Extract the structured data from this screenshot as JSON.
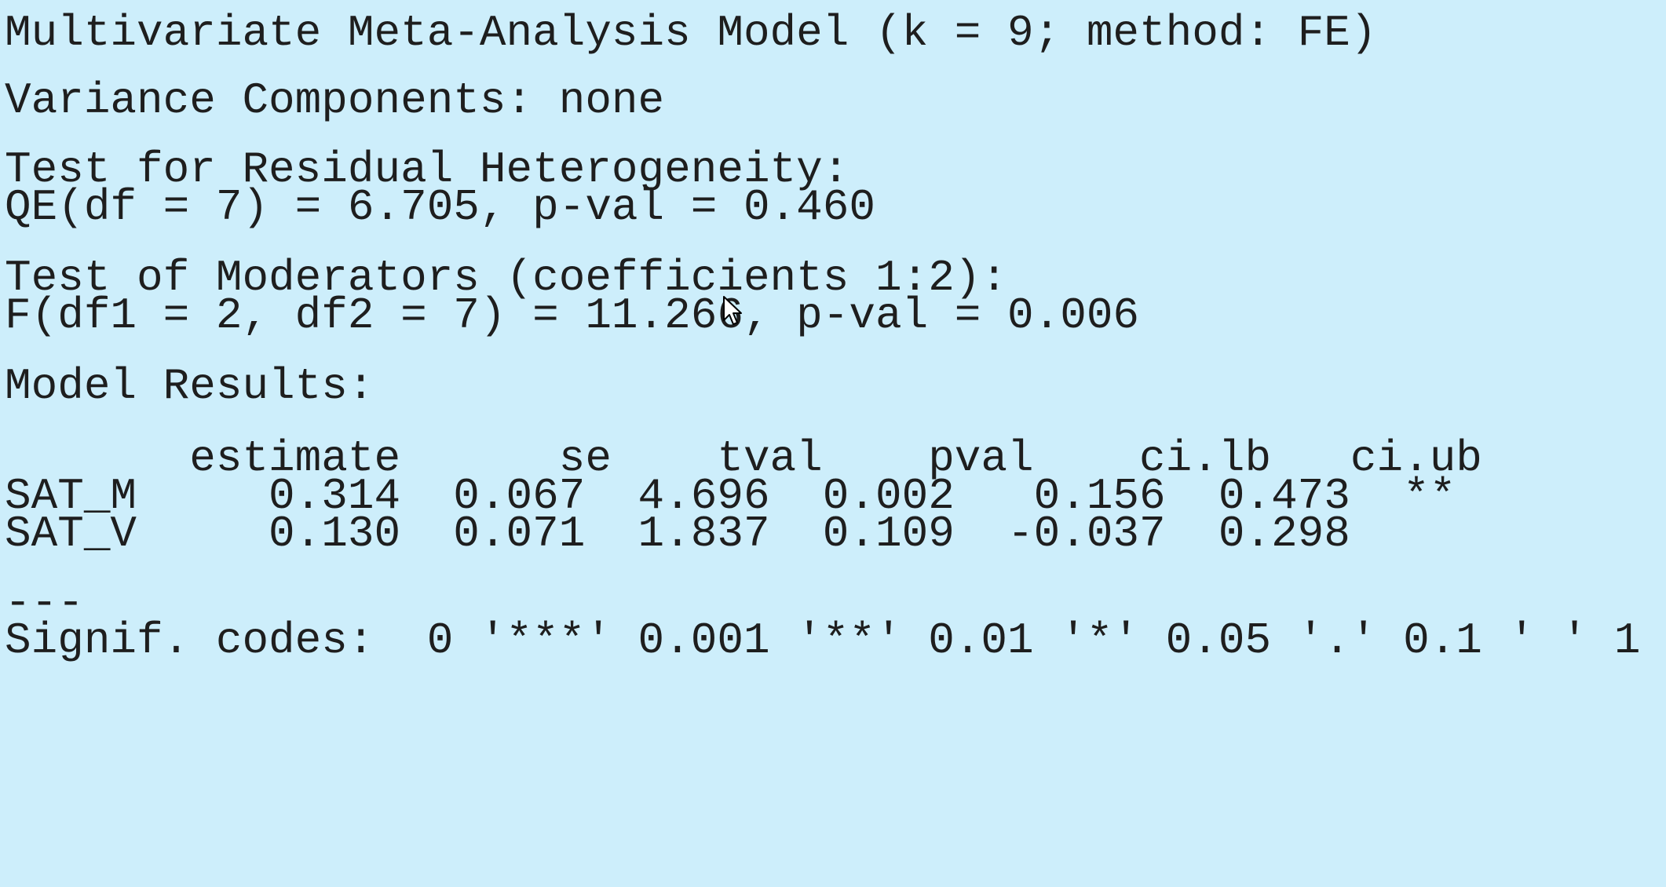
{
  "console": {
    "title_line": "Multivariate Meta-Analysis Model (k = 9; method: FE)",
    "variance_line": "Variance Components: none",
    "heterogeneity": {
      "heading": "Test for Residual Heterogeneity:",
      "value_line": "QE(df = 7) = 6.705, p-val = 0.460"
    },
    "moderators": {
      "heading": "Test of Moderators (coefficients 1:2):",
      "value_line": "F(df1 = 2, df2 = 7) = 11.266, p-val = 0.006"
    },
    "model_results": {
      "heading": "Model Results:",
      "header_line": "       estimate      se    tval    pval    ci.lb   ci.ub     ",
      "rows": [
        {
          "line": "SAT_M     0.314  0.067  4.696  0.002   0.156  0.473  **"
        },
        {
          "line": "SAT_V     0.130  0.071  1.837  0.109  -0.037  0.298    "
        }
      ]
    },
    "separator": "---",
    "signif_line": "Signif. codes:  0 '***' 0.001 '**' 0.01 '*' 0.05 '.' 0.1 ' ' 1"
  },
  "icons": {
    "cursor": "mouse-pointer-icon"
  }
}
